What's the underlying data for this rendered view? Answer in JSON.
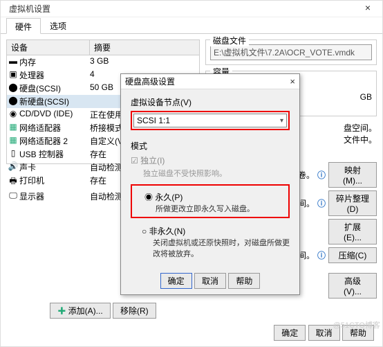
{
  "window": {
    "title": "虚拟机设置",
    "close": "×"
  },
  "tabs": {
    "hardware": "硬件",
    "options": "选项"
  },
  "device_list": {
    "head_device": "设备",
    "head_summary": "摘要",
    "rows": [
      {
        "name": "内存",
        "summary": "3 GB"
      },
      {
        "name": "处理器",
        "summary": "4"
      },
      {
        "name": "硬盘(SCSI)",
        "summary": "50 GB"
      },
      {
        "name": "新硬盘(SCSI)",
        "summary": ""
      },
      {
        "name": "CD/DVD (IDE)",
        "summary": "正在使用"
      },
      {
        "name": "网络适配器",
        "summary": "桥接模式("
      },
      {
        "name": "网络适配器 2",
        "summary": "自定义(VMn"
      },
      {
        "name": "USB 控制器",
        "summary": "存在"
      },
      {
        "name": "声卡",
        "summary": "自动检测"
      },
      {
        "name": "打印机",
        "summary": "存在"
      },
      {
        "name": "显示器",
        "summary": "自动检测"
      }
    ]
  },
  "disk": {
    "group_title": "磁盘文件",
    "path": "E:\\虚拟机文件\\7.2A\\OCR_VOTE.vmdk",
    "capacity_title": "容量",
    "capacity_value": "GB",
    "space_hint1": "盘空间。",
    "space_hint2": "文件中。",
    "map_label": "到本地卷。",
    "map_btn": "映射(M)...",
    "used_label": "用空间。",
    "defrag_btn": "碎片整理(D)",
    "expand_btn": "扩展(E)...",
    "compress_label": "用的空间。",
    "compress_btn": "压缩(C)",
    "advanced_btn": "高级(V)..."
  },
  "bottom": {
    "add": "添加(A)...",
    "remove": "移除(R)"
  },
  "main_buttons": {
    "ok": "确定",
    "cancel": "取消",
    "help": "帮助"
  },
  "modal": {
    "title": "硬盘高级设置",
    "close": "×",
    "vnode_label": "虚拟设备节点(V)",
    "vnode_value": "SCSI 1:1",
    "mode_label": "模式",
    "independent": "独立(I)",
    "independent_desc": "独立磁盘不受快照影响。",
    "permanent": "永久(P)",
    "permanent_desc": "所做更改立即永久写入磁盘。",
    "nonpermanent": "非永久(N)",
    "nonpermanent_desc": "关闭虚拟机或还原快照时，对磁盘所做更改将被放弃。",
    "ok": "确定",
    "cancel": "取消",
    "help": "帮助"
  },
  "watermark": "@51CTO博客"
}
